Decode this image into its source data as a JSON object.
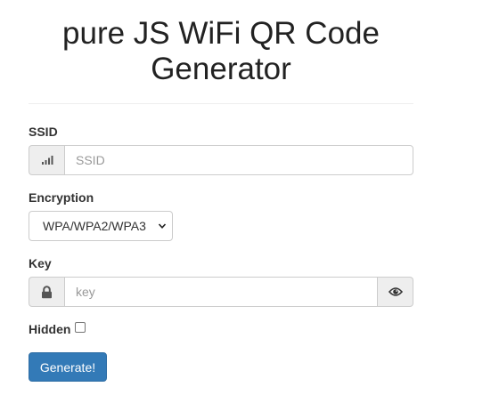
{
  "header": {
    "title": "pure JS WiFi QR Code Generator"
  },
  "ssid": {
    "label": "SSID",
    "placeholder": "SSID",
    "value": "",
    "icon": "signal-bars-icon"
  },
  "encryption": {
    "label": "Encryption",
    "selected": "WPA/WPA2/WPA3",
    "icon": "chevron-down-icon"
  },
  "key": {
    "label": "Key",
    "placeholder": "key",
    "value": "",
    "lock_icon": "lock-icon",
    "toggle_icon": "eye-icon"
  },
  "hidden": {
    "label": "Hidden",
    "checked": false
  },
  "actions": {
    "generate_label": "Generate!"
  },
  "colors": {
    "primary": "#337ab7",
    "addon_bg": "#eeeeee",
    "border": "#cccccc"
  }
}
